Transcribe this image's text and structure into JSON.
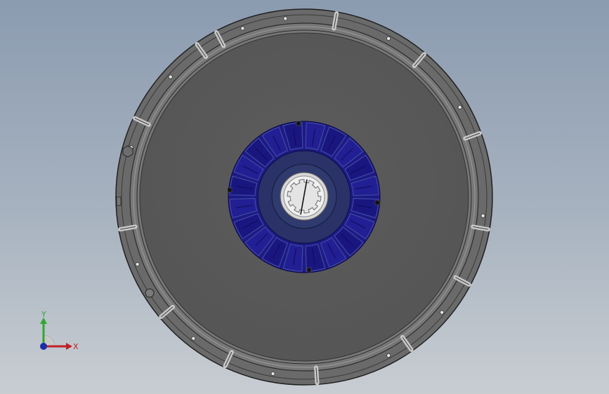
{
  "viewport": {
    "background_top": "#8b9bb0",
    "background_bottom": "#c8cdd2"
  },
  "model": {
    "name_hint": "clutch-disc-assembly",
    "colors": {
      "cover_face": "#5a5a5a",
      "cover_rim": "#6e6e6e",
      "edge_dark": "#2f2f2f",
      "lining_blue": "#1f1a8a",
      "lining_dark": "#14106a",
      "hub_blue": "#27346b",
      "hub_ring_light": "#c9c9c9",
      "spline_bore": "#e6e6e6"
    }
  },
  "triad": {
    "y_label": "Y",
    "x_label": "X",
    "y_color": "#2fa82f",
    "x_color": "#c0202a",
    "z_color": "#1c2fa8"
  }
}
